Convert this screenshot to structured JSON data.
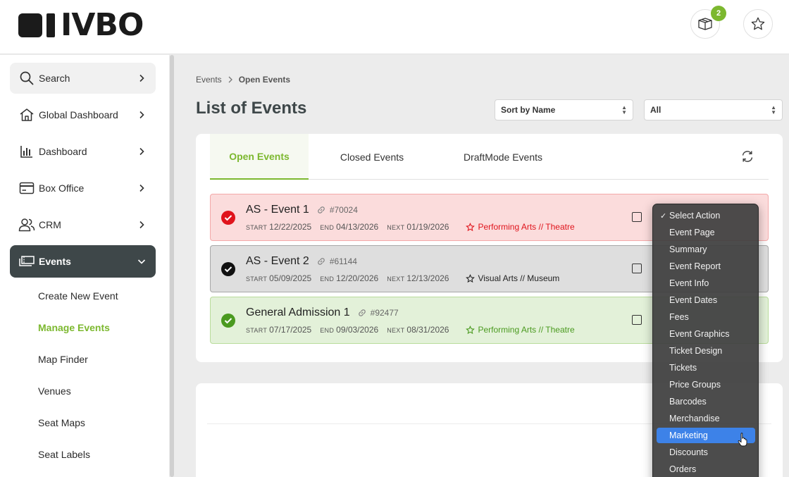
{
  "header": {
    "logo_text": "IVBO",
    "badge_count": "2"
  },
  "sidebar": {
    "items": [
      {
        "label": "Search"
      },
      {
        "label": "Global Dashboard"
      },
      {
        "label": "Dashboard"
      },
      {
        "label": "Box Office"
      },
      {
        "label": "CRM"
      },
      {
        "label": "Events"
      }
    ],
    "subitems": [
      {
        "label": "Create New Event"
      },
      {
        "label": "Manage Events"
      },
      {
        "label": "Map Finder"
      },
      {
        "label": "Venues"
      },
      {
        "label": "Seat Maps"
      },
      {
        "label": "Seat Labels"
      }
    ]
  },
  "breadcrumb": {
    "root": "Events",
    "current": "Open Events"
  },
  "page": {
    "title": "List of Events",
    "sort_value": "Sort by Name",
    "filter_value": "All"
  },
  "tabs": [
    {
      "label": "Open Events"
    },
    {
      "label": "Closed Events"
    },
    {
      "label": "DraftMode Events"
    }
  ],
  "date_keys": {
    "start": "START",
    "end": "END",
    "next": "NEXT"
  },
  "events": [
    {
      "name": "AS - Event 1",
      "id": "#70024",
      "start": "12/22/2025",
      "end": "04/13/2026",
      "next": "01/19/2026",
      "category": "Performing Arts // Theatre"
    },
    {
      "name": "AS - Event 2",
      "id": "#61144",
      "start": "05/09/2025",
      "end": "12/20/2026",
      "next": "12/13/2026",
      "category": "Visual Arts // Museum"
    },
    {
      "name": "General Admission 1",
      "id": "#92477",
      "start": "07/17/2025",
      "end": "09/03/2026",
      "next": "08/31/2026",
      "category": "Performing Arts // Theatre"
    }
  ],
  "action_menu": {
    "selected_check": "✓",
    "items": [
      "Select Action",
      "Event Page",
      "Summary",
      "Event Report",
      "Event Info",
      "Event Dates",
      "Fees",
      "Event Graphics",
      "Ticket Design",
      "Tickets",
      "Price Groups",
      "Barcodes",
      "Merchandise",
      "Marketing",
      "Discounts",
      "Orders"
    ],
    "highlighted": "Marketing"
  },
  "colors": {
    "accent": "#7cb82f",
    "danger": "#e0141c",
    "sidebar_active": "#3e4749",
    "menu_highlight": "#3d82e8"
  }
}
